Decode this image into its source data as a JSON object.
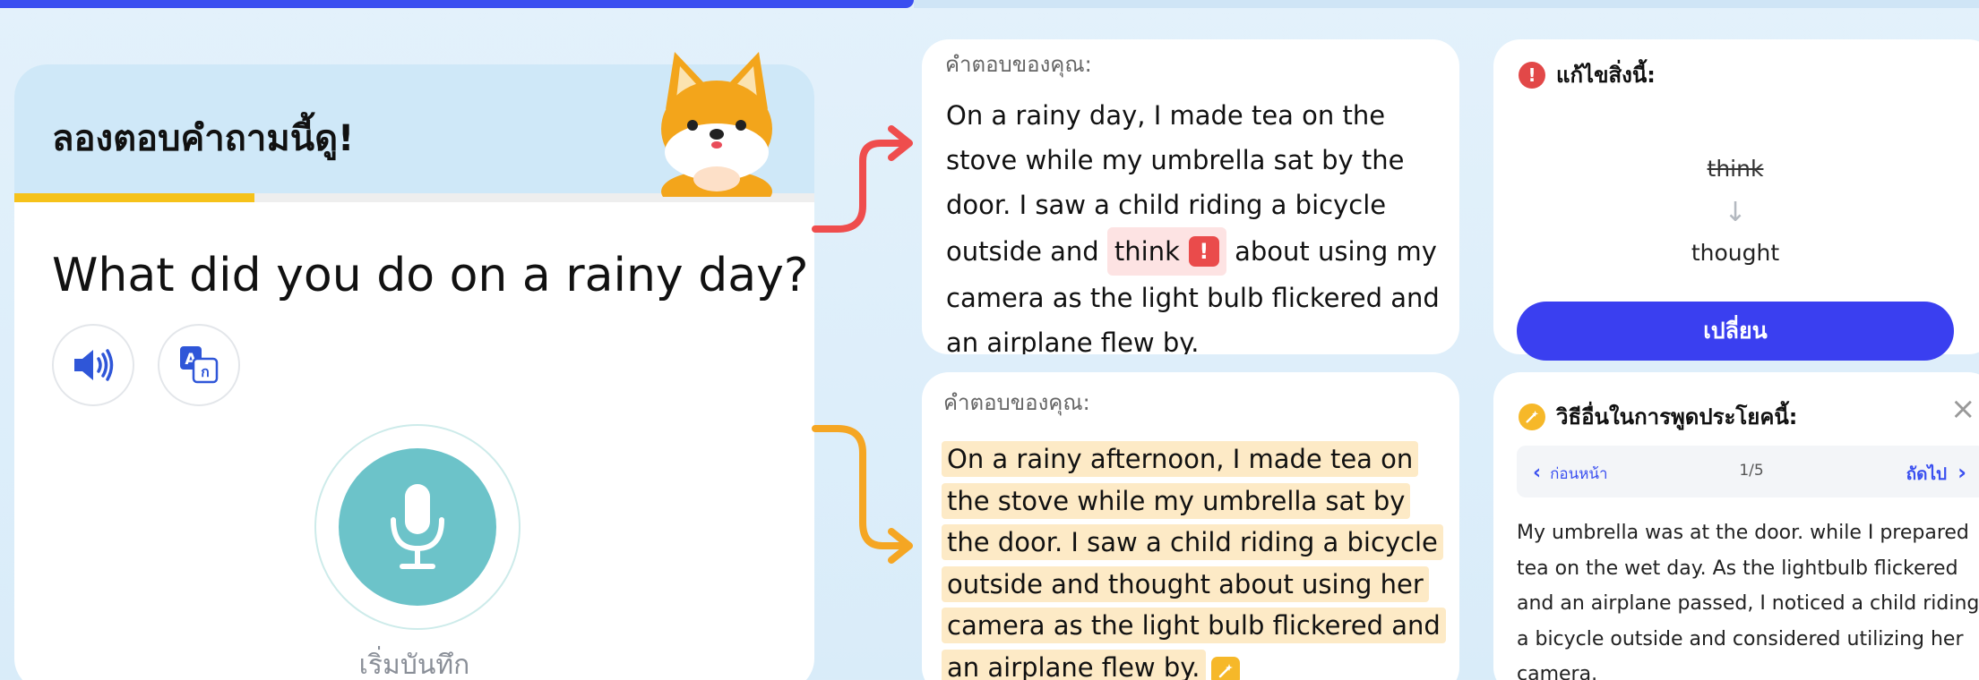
{
  "colors": {
    "primary": "#3a3ff0",
    "error": "#ea4b4b",
    "highlight": "#fdeac6",
    "mic": "#6cc3c9",
    "progress": "#f6c21a"
  },
  "question_card": {
    "header": "ลองตอบคำถามนี้ดู!",
    "question": "What did you do on a rainy day?",
    "progress": 0.3,
    "audio_icon": "speaker-icon",
    "translate_icon": "translate-icon",
    "mic_label": "เริ่มบันทึก"
  },
  "answer_card_1": {
    "label": "คำตอบของคุณ:",
    "text_before": "On a rainy day, I made tea on the stove while my umbrella sat by the door. I saw a child riding a bicycle outside and",
    "error_word": "think",
    "error_badge": "!",
    "text_after": "about using my camera as the light bulb flickered and an airplane flew by."
  },
  "answer_card_2": {
    "label": "คำตอบของคุณ:",
    "text": "On a rainy afternoon, I made tea on the stove while my umbrella sat by the door. I saw a child riding a bicycle outside and thought about using her camera as the light bulb flickered and an airplane flew by."
  },
  "fix_card": {
    "title": "แก้ไขสิ่งนี้:",
    "icon_text": "!",
    "old_word": "think",
    "arrow": "↓",
    "new_word": "thought",
    "button": "เปลี่ยน"
  },
  "alt_card": {
    "title": "วิธีอื่นในการพูดประโยคนี้:",
    "close": "×",
    "prev": "ก่อนหน้า",
    "prev_chevron": "‹",
    "count": "1/5",
    "next": "ถัดไป",
    "next_chevron": "›",
    "text": "My umbrella was at the door. while I prepared tea on the wet day. As the lightbulb flickered and an airplane passed, I noticed a child riding a bicycle outside and considered utilizing her camera."
  }
}
